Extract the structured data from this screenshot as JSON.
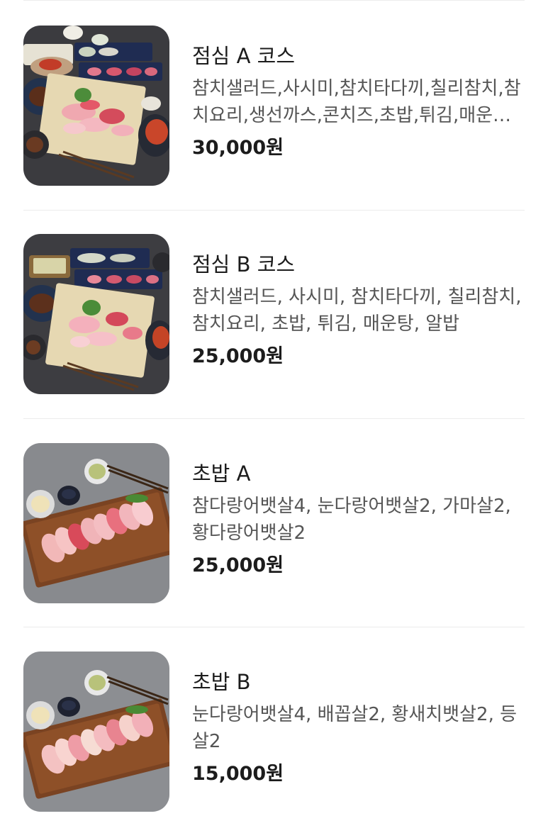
{
  "menu": [
    {
      "name": "점심 A 코스",
      "description": "참치샐러드,사시미,참치타다끼,칠리참치,참치요리,생선까스,콘치즈,초밥,튀김,매운탕,알밥",
      "price": "30,000원",
      "image": "course-set-photo"
    },
    {
      "name": "점심 B 코스",
      "description": "참치샐러드, 사시미, 참치타다끼, 칠리참치, 참치요리, 초밥, 튀김, 매운탕, 알밥",
      "price": "25,000원",
      "image": "course-set-photo"
    },
    {
      "name": "초밥 A",
      "description": "참다랑어뱃살4, 눈다랑어뱃살2, 가마살2, 황다랑어뱃살2",
      "price": "25,000원",
      "image": "sushi-board-photo"
    },
    {
      "name": "초밥 B",
      "description": "눈다랑어뱃살4, 배꼽살2, 황새치뱃살2, 등살2",
      "price": "15,000원",
      "image": "sushi-board-photo"
    }
  ]
}
